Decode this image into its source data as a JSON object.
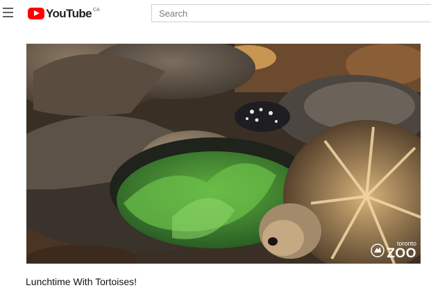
{
  "header": {
    "logo_text": "YouTube",
    "region_code": "CA",
    "search_placeholder": "Search"
  },
  "video": {
    "title": "Lunchtime With Tortoises!",
    "watermark_sub": "toronto",
    "watermark_main": "ZOO"
  },
  "icons": {
    "menu": "hamburger-menu",
    "logo": "youtube-play"
  },
  "colors": {
    "brand_red": "#ff0000",
    "text": "#111111"
  }
}
